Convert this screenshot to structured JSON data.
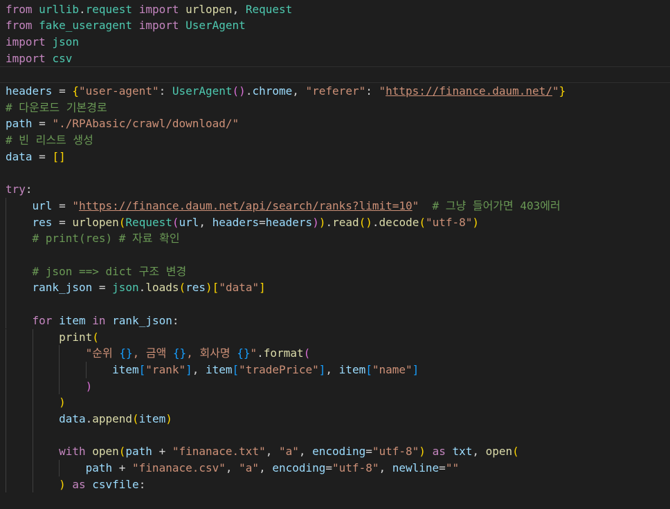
{
  "editor": {
    "language": "python",
    "theme": {
      "background": "#1e1e1e",
      "keyword": "#c586c0",
      "variable": "#9cdcfe",
      "class": "#4ec9b0",
      "function": "#dcdcaa",
      "string": "#ce9178",
      "comment": "#6a9955"
    },
    "lines": [
      [
        [
          "kw",
          "from"
        ],
        [
          "op",
          " "
        ],
        [
          "cls",
          "urllib"
        ],
        [
          "op",
          "."
        ],
        [
          "cls",
          "request"
        ],
        [
          "op",
          " "
        ],
        [
          "kw",
          "import"
        ],
        [
          "op",
          " "
        ],
        [
          "fn",
          "urlopen"
        ],
        [
          "op",
          ", "
        ],
        [
          "cls",
          "Request"
        ]
      ],
      [
        [
          "kw",
          "from"
        ],
        [
          "op",
          " "
        ],
        [
          "cls",
          "fake_useragent"
        ],
        [
          "op",
          " "
        ],
        [
          "kw",
          "import"
        ],
        [
          "op",
          " "
        ],
        [
          "cls",
          "UserAgent"
        ]
      ],
      [
        [
          "kw",
          "import"
        ],
        [
          "op",
          " "
        ],
        [
          "cls",
          "json"
        ]
      ],
      [
        [
          "kw",
          "import"
        ],
        [
          "op",
          " "
        ],
        [
          "cls",
          "csv"
        ]
      ],
      [],
      [
        [
          "id",
          "headers"
        ],
        [
          "op",
          " = "
        ],
        [
          "b1",
          "{"
        ],
        [
          "str",
          "\"user-agent\""
        ],
        [
          "op",
          ": "
        ],
        [
          "cls",
          "UserAgent"
        ],
        [
          "b2",
          "()"
        ],
        [
          "op",
          "."
        ],
        [
          "id",
          "chrome"
        ],
        [
          "op",
          ", "
        ],
        [
          "str",
          "\"referer\""
        ],
        [
          "op",
          ": "
        ],
        [
          "str",
          "\""
        ],
        [
          "url",
          "https://finance.daum.net/"
        ],
        [
          "str",
          "\""
        ],
        [
          "b1",
          "}"
        ]
      ],
      [
        [
          "com",
          "# 다운로드 기본경로"
        ]
      ],
      [
        [
          "id",
          "path"
        ],
        [
          "op",
          " = "
        ],
        [
          "str",
          "\"./RPAbasic/crawl/download/\""
        ]
      ],
      [
        [
          "com",
          "# 빈 리스트 생성"
        ]
      ],
      [
        [
          "id",
          "data"
        ],
        [
          "op",
          " = "
        ],
        [
          "b1",
          "[]"
        ]
      ],
      [],
      [
        [
          "kw",
          "try"
        ],
        [
          "op",
          ":"
        ]
      ],
      [
        [
          "op",
          "    "
        ],
        [
          "id",
          "url"
        ],
        [
          "op",
          " = "
        ],
        [
          "str",
          "\""
        ],
        [
          "url",
          "https://finance.daum.net/api/search/ranks?limit=10"
        ],
        [
          "str",
          "\""
        ],
        [
          "op",
          "  "
        ],
        [
          "com",
          "# 그냥 들어가면 403에러"
        ]
      ],
      [
        [
          "op",
          "    "
        ],
        [
          "id",
          "res"
        ],
        [
          "op",
          " = "
        ],
        [
          "fn",
          "urlopen"
        ],
        [
          "b1",
          "("
        ],
        [
          "cls",
          "Request"
        ],
        [
          "b2",
          "("
        ],
        [
          "id",
          "url"
        ],
        [
          "op",
          ", "
        ],
        [
          "id",
          "headers"
        ],
        [
          "op",
          "="
        ],
        [
          "id",
          "headers"
        ],
        [
          "b2",
          ")"
        ],
        [
          "b1",
          ")"
        ],
        [
          "op",
          "."
        ],
        [
          "fn",
          "read"
        ],
        [
          "b1",
          "()"
        ],
        [
          "op",
          "."
        ],
        [
          "fn",
          "decode"
        ],
        [
          "b1",
          "("
        ],
        [
          "str",
          "\"utf-8\""
        ],
        [
          "b1",
          ")"
        ]
      ],
      [
        [
          "op",
          "    "
        ],
        [
          "com",
          "# print(res) # 자료 확인"
        ]
      ],
      [],
      [
        [
          "op",
          "    "
        ],
        [
          "com",
          "# json ==> dict 구조 변경"
        ]
      ],
      [
        [
          "op",
          "    "
        ],
        [
          "id",
          "rank_json"
        ],
        [
          "op",
          " = "
        ],
        [
          "cls",
          "json"
        ],
        [
          "op",
          "."
        ],
        [
          "fn",
          "loads"
        ],
        [
          "b1",
          "("
        ],
        [
          "id",
          "res"
        ],
        [
          "b1",
          ")"
        ],
        [
          "b1",
          "["
        ],
        [
          "str",
          "\"data\""
        ],
        [
          "b1",
          "]"
        ]
      ],
      [],
      [
        [
          "op",
          "    "
        ],
        [
          "kw",
          "for"
        ],
        [
          "op",
          " "
        ],
        [
          "id",
          "item"
        ],
        [
          "op",
          " "
        ],
        [
          "kw",
          "in"
        ],
        [
          "op",
          " "
        ],
        [
          "id",
          "rank_json"
        ],
        [
          "op",
          ":"
        ]
      ],
      [
        [
          "op",
          "        "
        ],
        [
          "fn",
          "print"
        ],
        [
          "b1",
          "("
        ]
      ],
      [
        [
          "op",
          "            "
        ],
        [
          "str",
          "\"순위 "
        ],
        [
          "b3",
          "{}"
        ],
        [
          "str",
          ", 금액 "
        ],
        [
          "b3",
          "{}"
        ],
        [
          "str",
          ", 회사명 "
        ],
        [
          "b3",
          "{}"
        ],
        [
          "str",
          "\""
        ],
        [
          "op",
          "."
        ],
        [
          "fn",
          "format"
        ],
        [
          "b2",
          "("
        ]
      ],
      [
        [
          "op",
          "                "
        ],
        [
          "id",
          "item"
        ],
        [
          "b3",
          "["
        ],
        [
          "str",
          "\"rank\""
        ],
        [
          "b3",
          "]"
        ],
        [
          "op",
          ", "
        ],
        [
          "id",
          "item"
        ],
        [
          "b3",
          "["
        ],
        [
          "str",
          "\"tradePrice\""
        ],
        [
          "b3",
          "]"
        ],
        [
          "op",
          ", "
        ],
        [
          "id",
          "item"
        ],
        [
          "b3",
          "["
        ],
        [
          "str",
          "\"name\""
        ],
        [
          "b3",
          "]"
        ]
      ],
      [
        [
          "op",
          "            "
        ],
        [
          "b2",
          ")"
        ]
      ],
      [
        [
          "op",
          "        "
        ],
        [
          "b1",
          ")"
        ]
      ],
      [
        [
          "op",
          "        "
        ],
        [
          "id",
          "data"
        ],
        [
          "op",
          "."
        ],
        [
          "fn",
          "append"
        ],
        [
          "b1",
          "("
        ],
        [
          "id",
          "item"
        ],
        [
          "b1",
          ")"
        ]
      ],
      [],
      [
        [
          "op",
          "        "
        ],
        [
          "kw",
          "with"
        ],
        [
          "op",
          " "
        ],
        [
          "fn",
          "open"
        ],
        [
          "b1",
          "("
        ],
        [
          "id",
          "path"
        ],
        [
          "op",
          " + "
        ],
        [
          "str",
          "\"finanace.txt\""
        ],
        [
          "op",
          ", "
        ],
        [
          "str",
          "\"a\""
        ],
        [
          "op",
          ", "
        ],
        [
          "id",
          "encoding"
        ],
        [
          "op",
          "="
        ],
        [
          "str",
          "\"utf-8\""
        ],
        [
          "b1",
          ")"
        ],
        [
          "op",
          " "
        ],
        [
          "kw",
          "as"
        ],
        [
          "op",
          " "
        ],
        [
          "id",
          "txt"
        ],
        [
          "op",
          ", "
        ],
        [
          "fn",
          "open"
        ],
        [
          "b1",
          "("
        ]
      ],
      [
        [
          "op",
          "            "
        ],
        [
          "id",
          "path"
        ],
        [
          "op",
          " + "
        ],
        [
          "str",
          "\"finanace.csv\""
        ],
        [
          "op",
          ", "
        ],
        [
          "str",
          "\"a\""
        ],
        [
          "op",
          ", "
        ],
        [
          "id",
          "encoding"
        ],
        [
          "op",
          "="
        ],
        [
          "str",
          "\"utf-8\""
        ],
        [
          "op",
          ", "
        ],
        [
          "id",
          "newline"
        ],
        [
          "op",
          "="
        ],
        [
          "str",
          "\"\""
        ]
      ],
      [
        [
          "op",
          "        "
        ],
        [
          "b1",
          ")"
        ],
        [
          "op",
          " "
        ],
        [
          "kw",
          "as"
        ],
        [
          "op",
          " "
        ],
        [
          "id",
          "csvfile"
        ],
        [
          "op",
          ":"
        ]
      ],
      []
    ]
  }
}
